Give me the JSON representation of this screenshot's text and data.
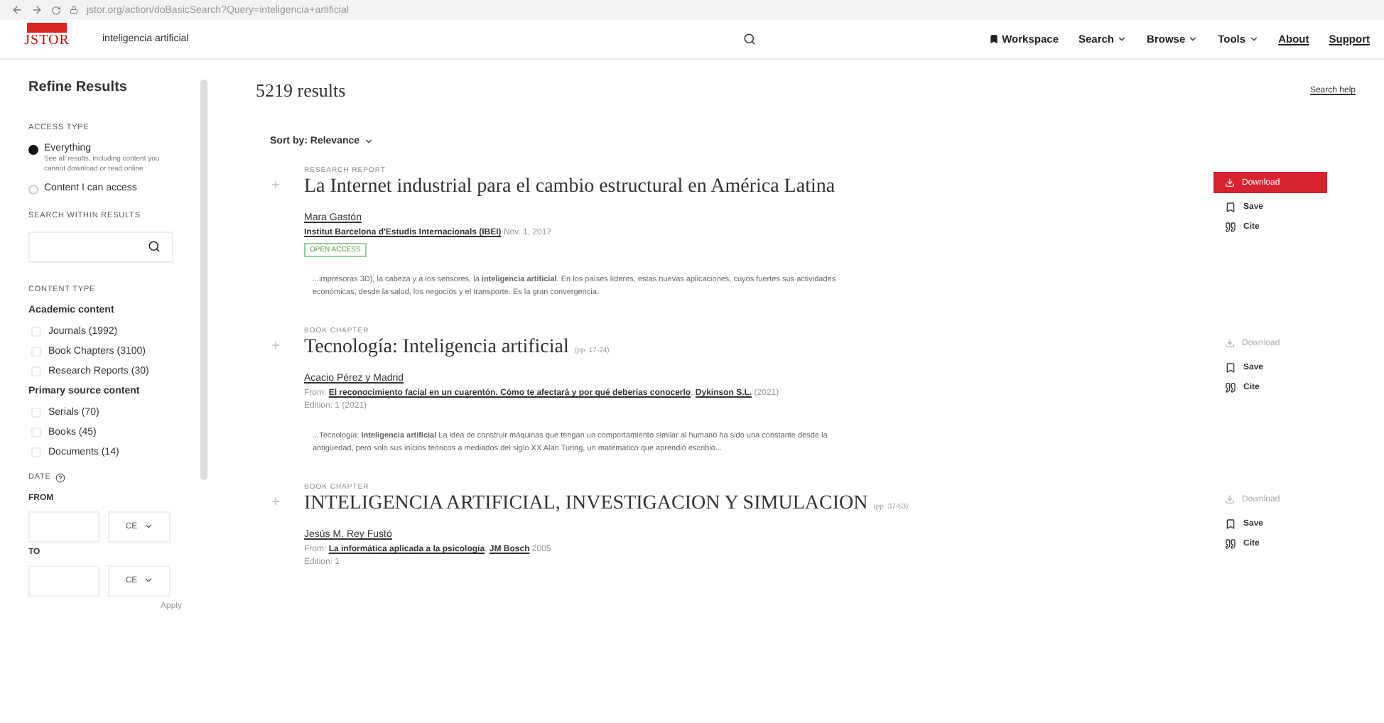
{
  "browser": {
    "url": "jstor.org/action/doBasicSearch?Query=inteligencia+artificial"
  },
  "header": {
    "logo_top": "JSTOR",
    "search_value": "inteligencia artificial",
    "nav": [
      {
        "label": "Workspace",
        "kind": "workspace"
      },
      {
        "label": "Search",
        "kind": "dropdown"
      },
      {
        "label": "Browse",
        "kind": "dropdown"
      },
      {
        "label": "Tools",
        "kind": "dropdown"
      },
      {
        "label": "About",
        "kind": "link"
      },
      {
        "label": "Support",
        "kind": "link"
      }
    ]
  },
  "sidebar": {
    "title": "Refine Results",
    "access_heading": "ACCESS TYPE",
    "access_options": [
      {
        "label": "Everything",
        "description": "See all results, including content you cannot download or read online",
        "selected": true
      },
      {
        "label": "Content I can access",
        "selected": false
      }
    ],
    "search_within_heading": "SEARCH WITHIN RESULTS",
    "content_heading": "CONTENT TYPE",
    "content_groups": [
      {
        "title": "Academic content",
        "items": [
          {
            "label": "Journals (1992)",
            "checked": false
          },
          {
            "label": "Book Chapters (3100)",
            "checked": false
          },
          {
            "label": "Research Reports (30)",
            "checked": false
          }
        ]
      },
      {
        "title": "Primary source content",
        "items": [
          {
            "label": "Serials (70)",
            "checked": false
          },
          {
            "label": "Books (45)",
            "checked": false
          },
          {
            "label": "Documents (14)",
            "checked": false
          }
        ]
      }
    ],
    "date_heading": "DATE",
    "from_label": "FROM",
    "from_era": "CE",
    "to_label": "TO",
    "to_era": "CE",
    "apply": "Apply"
  },
  "results": {
    "count": "5219 results",
    "search_help": "Search help",
    "sort": "Sort by: Relevance",
    "items": [
      {
        "type": "RESEARCH REPORT",
        "title": "La Internet industrial para el cambio estructural en América Latina",
        "author": "Mara Gastón",
        "source_link": "Institut Barcelona d'Estudis Internacionals (IBEI)",
        "date": "Nov. 1, 2017",
        "open_access": "OPEN ACCESS",
        "snippet": "...impresoras 3D), la cabeza y a los sensores, la **inteligencia artificial**. En los países líderes, estas nuevas aplicaciones, cuyos fuertes sus actividades económicas, desde la salud, los negocios y el transporte. Es la gran convergencia.",
        "download": "Download",
        "download_enabled": true,
        "save": "Save",
        "cite": "Cite"
      },
      {
        "type": "BOOK CHAPTER",
        "title": "Tecnología: Inteligencia artificial",
        "pages": "(pp. 17-24)",
        "author": "Acacio Pérez y Madrid",
        "from_label": "From:",
        "book_link": "El reconocimiento facial en un cuarentón. Cómo te afectará y por qué deberías conocerlo",
        "separator": ",",
        "publisher_link": "Dykinson S.L.",
        "year": "(2021)",
        "edition": "Edition: 1 (2021)",
        "snippet": "...Tecnología: **Inteligencia artificial** La idea de construir máquinas que tengan un comportamiento similar al humano ha sido una constante desde la antigüedad, pero solo sus inicios teóricos a mediados del siglo XX Alan Turing, un matemático que aprendió escribió...",
        "download": "Download",
        "download_enabled": false,
        "save": "Save",
        "cite": "Cite"
      },
      {
        "type": "BOOK CHAPTER",
        "title": "INTELIGENCIA ARTIFICIAL, INVESTIGACION Y SIMULACION",
        "pages": "(pp. 37-53)",
        "author": "Jesús M. Rey Fustó",
        "from_label": "From:",
        "book_link": "La informática aplicada a la psicología",
        "separator": ",",
        "publisher_link": "JM Bosch",
        "year": "2005",
        "edition": "Edition: 1",
        "download": "Download",
        "download_enabled": false,
        "save": "Save",
        "cite": "Cite"
      }
    ]
  }
}
